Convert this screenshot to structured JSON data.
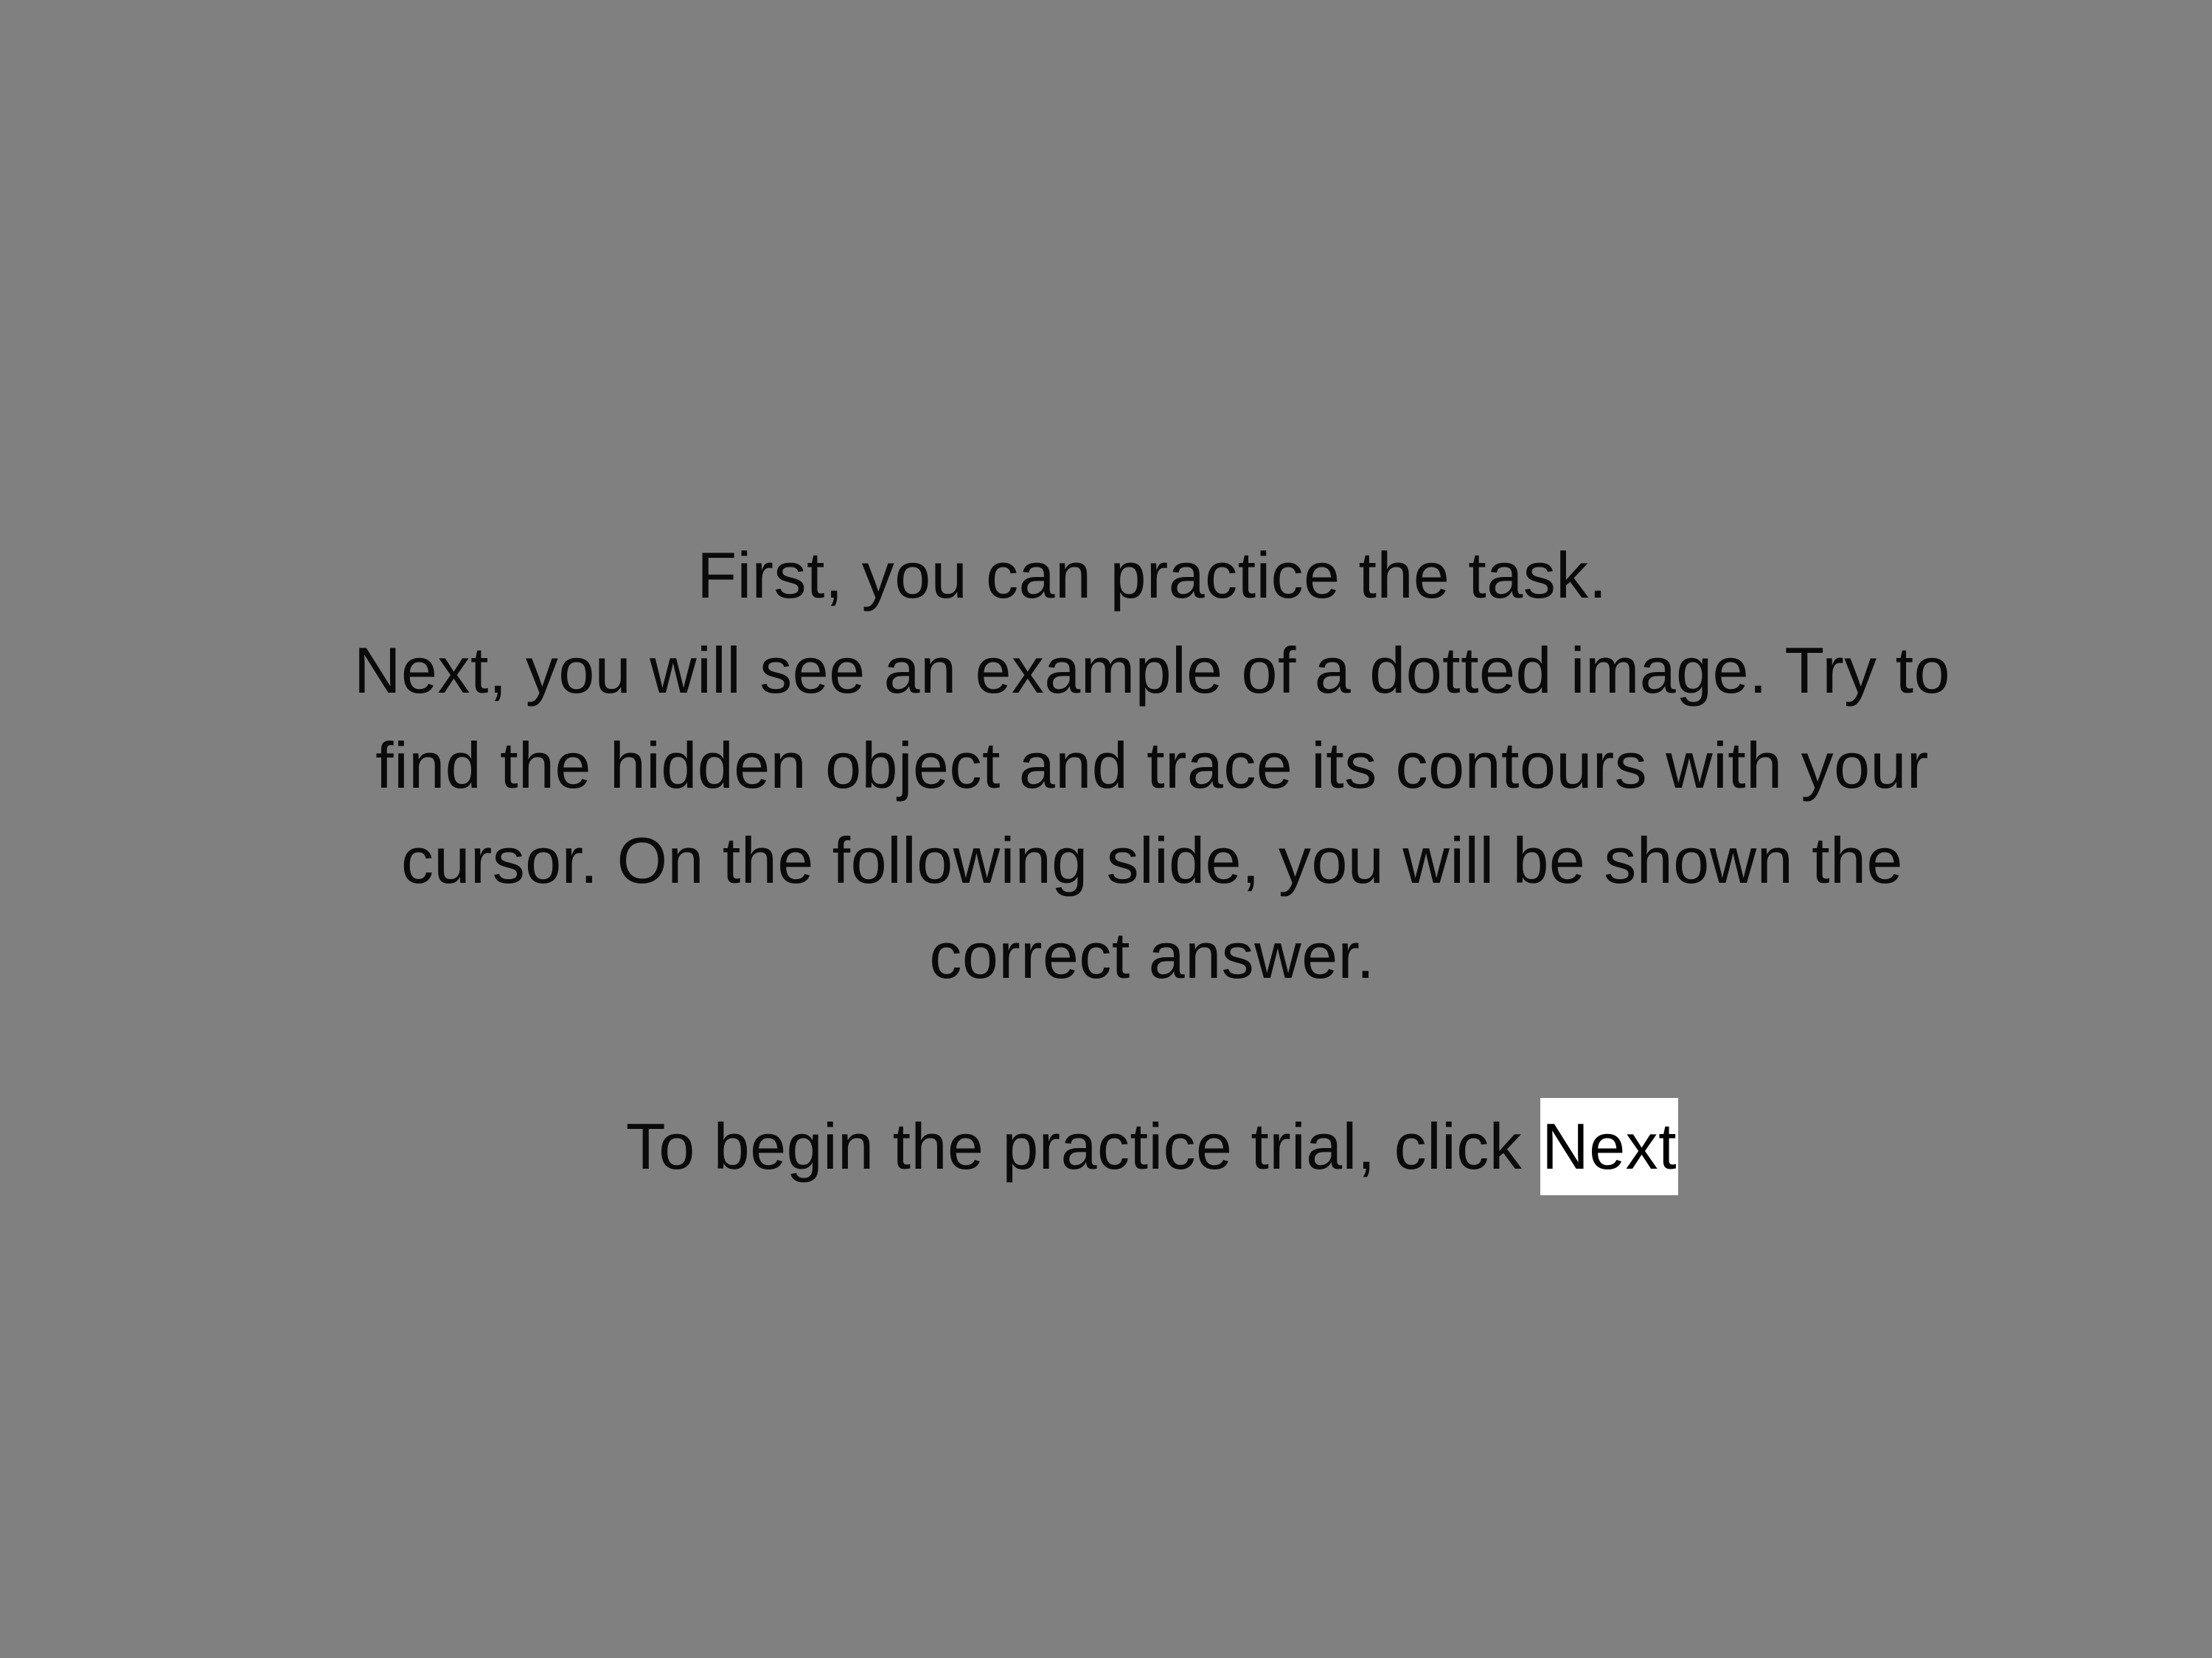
{
  "slide": {
    "background_color": "#808080",
    "lines": [
      "First, you can practice the task.",
      "Next, you will see an example of a dotted image. Try to",
      "find the hidden object and trace its contours with your",
      "cursor. On the following slide, you will be shown the",
      "correct answer."
    ],
    "begin_prompt": "To begin the practice trial, click",
    "next_label": "Next"
  }
}
